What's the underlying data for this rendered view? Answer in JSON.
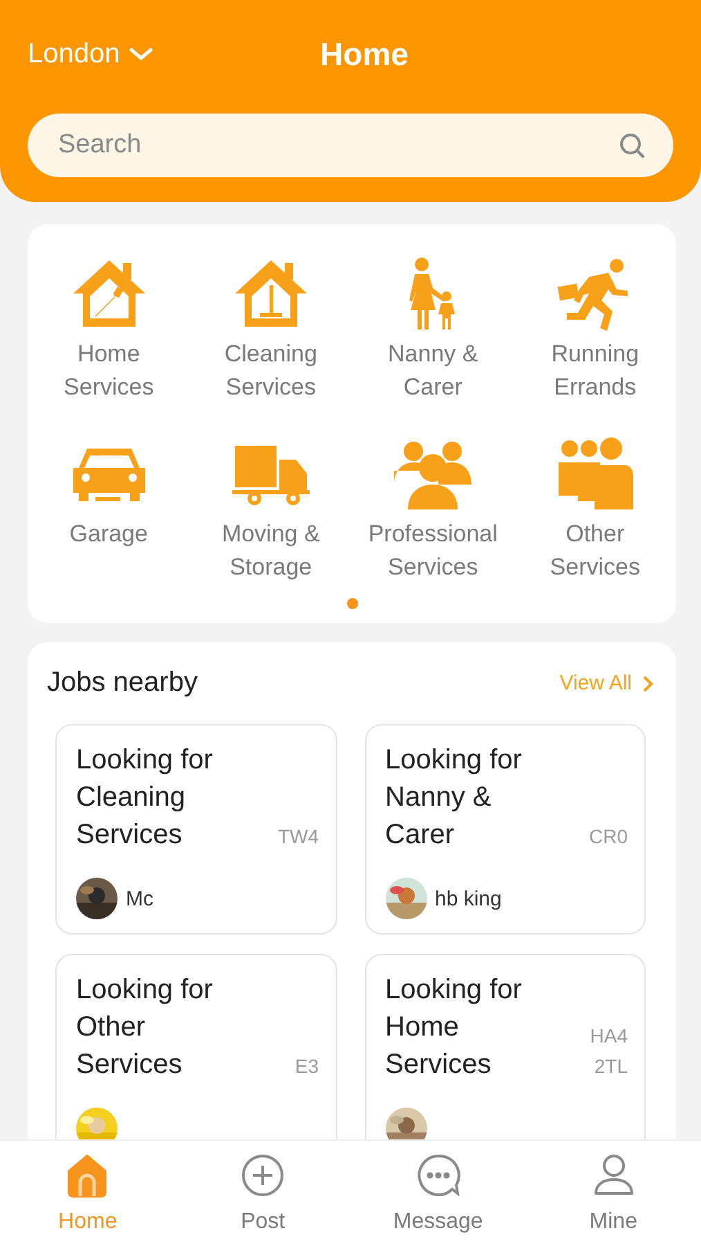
{
  "header": {
    "location": "London",
    "title": "Home"
  },
  "search": {
    "placeholder": "Search"
  },
  "categories": [
    {
      "label": "Home Services"
    },
    {
      "label": "Cleaning Services"
    },
    {
      "label": "Nanny & Carer"
    },
    {
      "label": "Running Errands"
    },
    {
      "label": "Garage"
    },
    {
      "label": "Moving & Storage"
    },
    {
      "label": "Professional Services"
    },
    {
      "label": "Other Services"
    }
  ],
  "pager": [
    {
      "selected": true
    }
  ],
  "jobs_nearby": {
    "title": "Jobs nearby",
    "view_all": "View All",
    "jobs": [
      {
        "title": "Looking for Cleaning Services",
        "postcode": "TW4",
        "user": "Mc"
      },
      {
        "title": "Looking for Nanny & Carer",
        "postcode": "CR0",
        "user": "hb king"
      },
      {
        "title": "Looking for Other Services",
        "postcode": "E3"
      },
      {
        "title": "Looking for Home Services",
        "postcode": "HA4 2TL"
      }
    ]
  },
  "tab_bar": [
    {
      "label": "Home",
      "selected": true
    },
    {
      "label": "Post",
      "selected": false
    },
    {
      "label": "Message",
      "selected": false
    },
    {
      "label": "Mine",
      "selected": false
    }
  ]
}
